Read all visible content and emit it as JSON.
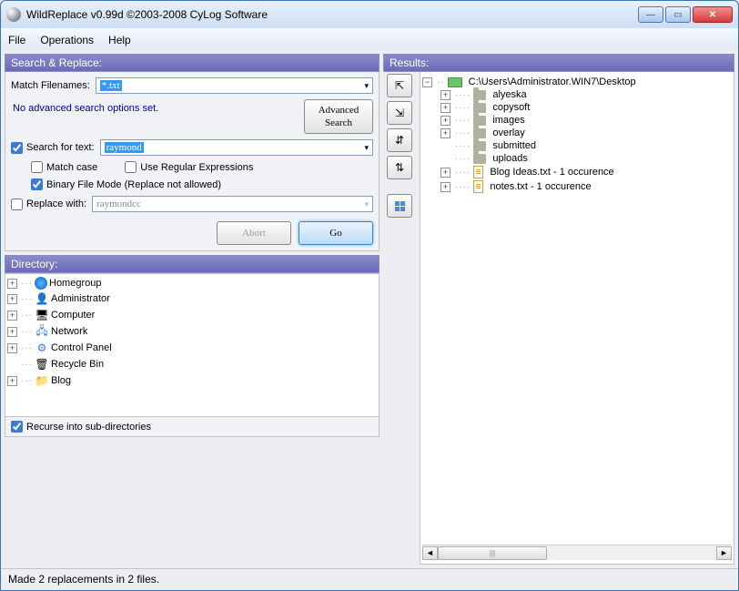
{
  "title": "WildReplace v0.99d ©2003-2008 CyLog Software",
  "menu": {
    "file": "File",
    "operations": "Operations",
    "help": "Help"
  },
  "sr": {
    "header": "Search & Replace:",
    "match_label": "Match Filenames:",
    "match_value": "*.txt",
    "adv_status": "No advanced search options set.",
    "adv_btn": "Advanced\nSearch",
    "search_text_label": "Search for text:",
    "search_text_value": "raymond",
    "match_case": "Match case",
    "regex": "Use Regular Expressions",
    "binary": "Binary File Mode (Replace not allowed)",
    "replace_label": "Replace with:",
    "replace_value": "raymondcc",
    "abort": "Abort",
    "go": "Go"
  },
  "dir": {
    "header": "Directory:",
    "items": [
      {
        "name": "Homegroup",
        "icon": "home-icon",
        "exp": "+"
      },
      {
        "name": "Administrator",
        "icon": "user-icon",
        "exp": "+"
      },
      {
        "name": "Computer",
        "icon": "comp-icon",
        "exp": "+"
      },
      {
        "name": "Network",
        "icon": "net-icon",
        "exp": "+"
      },
      {
        "name": "Control Panel",
        "icon": "cp-icon",
        "exp": "+"
      },
      {
        "name": "Recycle Bin",
        "icon": "rec-icon",
        "exp": ""
      },
      {
        "name": "Blog",
        "icon": "folder-icon-y",
        "exp": "+"
      }
    ],
    "recurse": "Recurse into sub-directories"
  },
  "results": {
    "header": "Results:",
    "root": "C:\\Users\\Administrator.WIN7\\Desktop",
    "items": [
      {
        "name": "alyeska",
        "type": "folder",
        "exp": "+"
      },
      {
        "name": "copysoft",
        "type": "folder",
        "exp": "+"
      },
      {
        "name": "images",
        "type": "folder",
        "exp": "+"
      },
      {
        "name": "overlay",
        "type": "folder",
        "exp": "+"
      },
      {
        "name": "submitted",
        "type": "folder",
        "exp": ""
      },
      {
        "name": "uploads",
        "type": "folder",
        "exp": ""
      },
      {
        "name": "Blog Ideas.txt - 1 occurence",
        "type": "doc",
        "exp": "+"
      },
      {
        "name": "notes.txt - 1 occurence",
        "type": "doc",
        "exp": "+"
      }
    ]
  },
  "status": "Made 2 replacements in 2 files."
}
